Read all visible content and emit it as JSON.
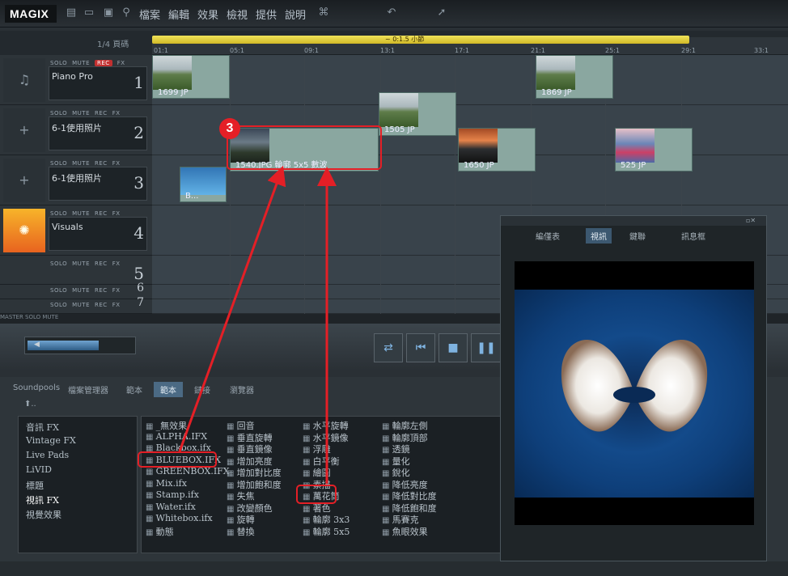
{
  "app": {
    "logo": "MAGIX"
  },
  "menu": [
    "檔案",
    "編輯",
    "效果",
    "檢視",
    "提供",
    "說明"
  ],
  "toolbar_icons": [
    "new-icon",
    "open-icon",
    "save-icon",
    "search-icon",
    "lock-icon",
    "undo-icon",
    "pointer-icon"
  ],
  "timeline": {
    "page_label": "1/4 頁碼",
    "loop_label": "~ 0:1.5 小節",
    "ticks": [
      "01:1",
      "05:1",
      "09:1",
      "13:1",
      "17:1",
      "21:1",
      "25:1",
      "29:1",
      "33:1"
    ]
  },
  "tracks": [
    {
      "name": "Piano Pro",
      "number": "1",
      "buttons": [
        "SOLO",
        "MUTE",
        "REC",
        "FX"
      ]
    },
    {
      "name": "6-1使用照片",
      "number": "2",
      "buttons": [
        "SOLO",
        "MUTE",
        "REC",
        "FX"
      ]
    },
    {
      "name": "6-1使用照片",
      "number": "3",
      "buttons": [
        "SOLO",
        "MUTE",
        "REC",
        "FX"
      ]
    },
    {
      "name": "Visuals",
      "number": "4",
      "buttons": [
        "SOLO",
        "MUTE",
        "REC",
        "FX"
      ]
    },
    {
      "name": "",
      "number": "5",
      "buttons": [
        "SOLO",
        "MUTE",
        "REC",
        "FX"
      ]
    },
    {
      "name": "",
      "number": "6",
      "buttons": [
        "SOLO",
        "MUTE",
        "REC",
        "FX"
      ]
    },
    {
      "name": "",
      "number": "7",
      "buttons": [
        "SOLO",
        "MUTE",
        "REC",
        "FX"
      ]
    }
  ],
  "clips": {
    "c1": "1699 JP",
    "c2": "1869 JP",
    "c3": "1505 JP",
    "c4": "1540.JPG  輪廓 5x5  數波",
    "c5": "1650 JP",
    "c6": "525 JP",
    "c7": "B..."
  },
  "track_footer": "MASTER  SOLO  MUTE",
  "transport_buttons": [
    "loop-icon",
    "skip-back-icon",
    "stop-icon",
    "pause-icon"
  ],
  "pool": {
    "tabs": [
      "Soundpools",
      "檔案管理器",
      "範本",
      "範本",
      "鏈接",
      "瀏覽器"
    ],
    "active_tab": 3,
    "path": "⬆..",
    "categories": [
      "音訊 FX",
      "Vintage FX",
      "Live Pads",
      "LiVID",
      "標題",
      "視訊 FX",
      "視覺效果"
    ],
    "files": [
      [
        "_無效果",
        "ALPHA.IFX",
        "Blackbox.ifx",
        "BLUEBOX.IFX",
        "GREENBOX.IFX",
        "Mix.ifx",
        "Stamp.ifx",
        "Water.ifx",
        "Whitebox.ifx",
        "動態"
      ],
      [
        "回音",
        "垂直旋轉",
        "垂直鏡像",
        "增加亮度",
        "增加對比度",
        "增加飽和度",
        "失焦",
        "改變顏色",
        "旋轉",
        "替換"
      ],
      [
        "水平旋轉",
        "水平鏡像",
        "浮雕",
        "白平衡",
        "繪圖",
        "素描",
        "萬花筒",
        "著色",
        "輪廓 3x3",
        "輪廓 5x5"
      ],
      [
        "輪廓左側",
        "輪廓頂部",
        "透鏡",
        "量化",
        "銳化",
        "降低亮度",
        "降低對比度",
        "降低飽和度",
        "馬賽克",
        "魚眼效果"
      ]
    ]
  },
  "preview": {
    "tabs": [
      "編僅表",
      "視訊",
      "鍵聯",
      "訊息框"
    ],
    "active_tab": 1
  },
  "annotation": {
    "step": "3",
    "color": "#e41f26"
  }
}
